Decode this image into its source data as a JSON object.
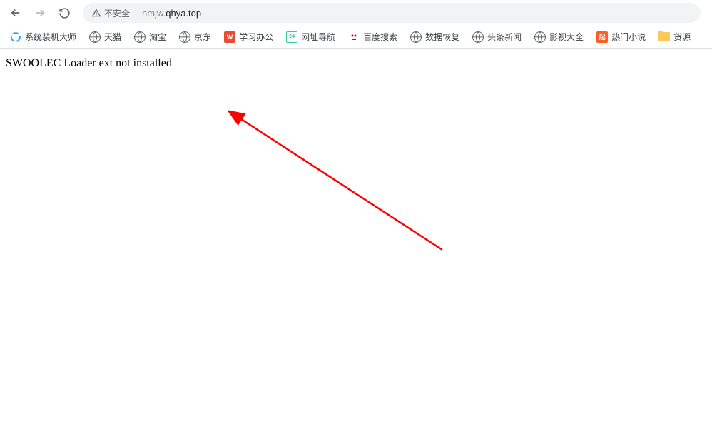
{
  "toolbar": {
    "security_label": "不安全",
    "url_subdomain": "nmjw.",
    "url_domain": "qhya.top"
  },
  "bookmarks": [
    {
      "label": "系统装机大师",
      "iconType": "custom-blue"
    },
    {
      "label": "天猫",
      "iconType": "globe"
    },
    {
      "label": "淘宝",
      "iconType": "globe"
    },
    {
      "label": "京东",
      "iconType": "globe"
    },
    {
      "label": "学习办公",
      "iconType": "square-red"
    },
    {
      "label": "网址导航",
      "iconType": "custom-2345"
    },
    {
      "label": "百度搜索",
      "iconType": "custom-baidu"
    },
    {
      "label": "数据恢复",
      "iconType": "globe"
    },
    {
      "label": "头条新闻",
      "iconType": "globe"
    },
    {
      "label": "影视大全",
      "iconType": "globe"
    },
    {
      "label": "热门小说",
      "iconType": "square-orange"
    },
    {
      "label": "货源",
      "iconType": "folder"
    }
  ],
  "page": {
    "error_message": "SWOOLEC Loader ext not installed"
  }
}
